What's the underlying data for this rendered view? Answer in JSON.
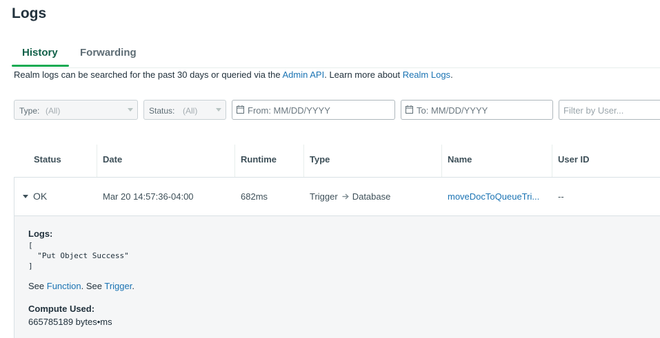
{
  "page": {
    "title": "Logs"
  },
  "tabs": [
    {
      "label": "History",
      "active": true
    },
    {
      "label": "Forwarding",
      "active": false
    }
  ],
  "info": {
    "prefix": "Realm logs can be searched for the past 30 days or queried via the ",
    "admin_api_link": "Admin API",
    "middle": ". Learn more about ",
    "realm_logs_link": "Realm Logs",
    "suffix": "."
  },
  "filters": {
    "type": {
      "label": "Type:",
      "value": "(All)"
    },
    "status": {
      "label": "Status:",
      "value": "(All)"
    },
    "from": {
      "placeholder": "From: MM/DD/YYYY"
    },
    "to": {
      "placeholder": "To: MM/DD/YYYY"
    },
    "user": {
      "placeholder": "Filter by User..."
    }
  },
  "table": {
    "columns": [
      "Status",
      "Date",
      "Runtime",
      "Type",
      "Name",
      "User ID"
    ],
    "rows": [
      {
        "status": "OK",
        "date": "Mar 20 14:57:36-04:00",
        "runtime": "682ms",
        "type_from": "Trigger",
        "type_to": "Database",
        "name": "moveDocToQueueTri...",
        "user_id": "--"
      }
    ]
  },
  "details": {
    "logs_label": "Logs:",
    "logs_content": "[\n  \"Put Object Success\"\n]",
    "see_prefix": "See ",
    "function_link": "Function",
    "see_middle": ". See ",
    "trigger_link": "Trigger",
    "see_suffix": ".",
    "compute_label": "Compute Used:",
    "compute_value": "665785189 bytes•ms"
  },
  "colors": {
    "active_tab": "#116149",
    "tab_underline": "#13aa52",
    "link": "#1a73b3"
  }
}
